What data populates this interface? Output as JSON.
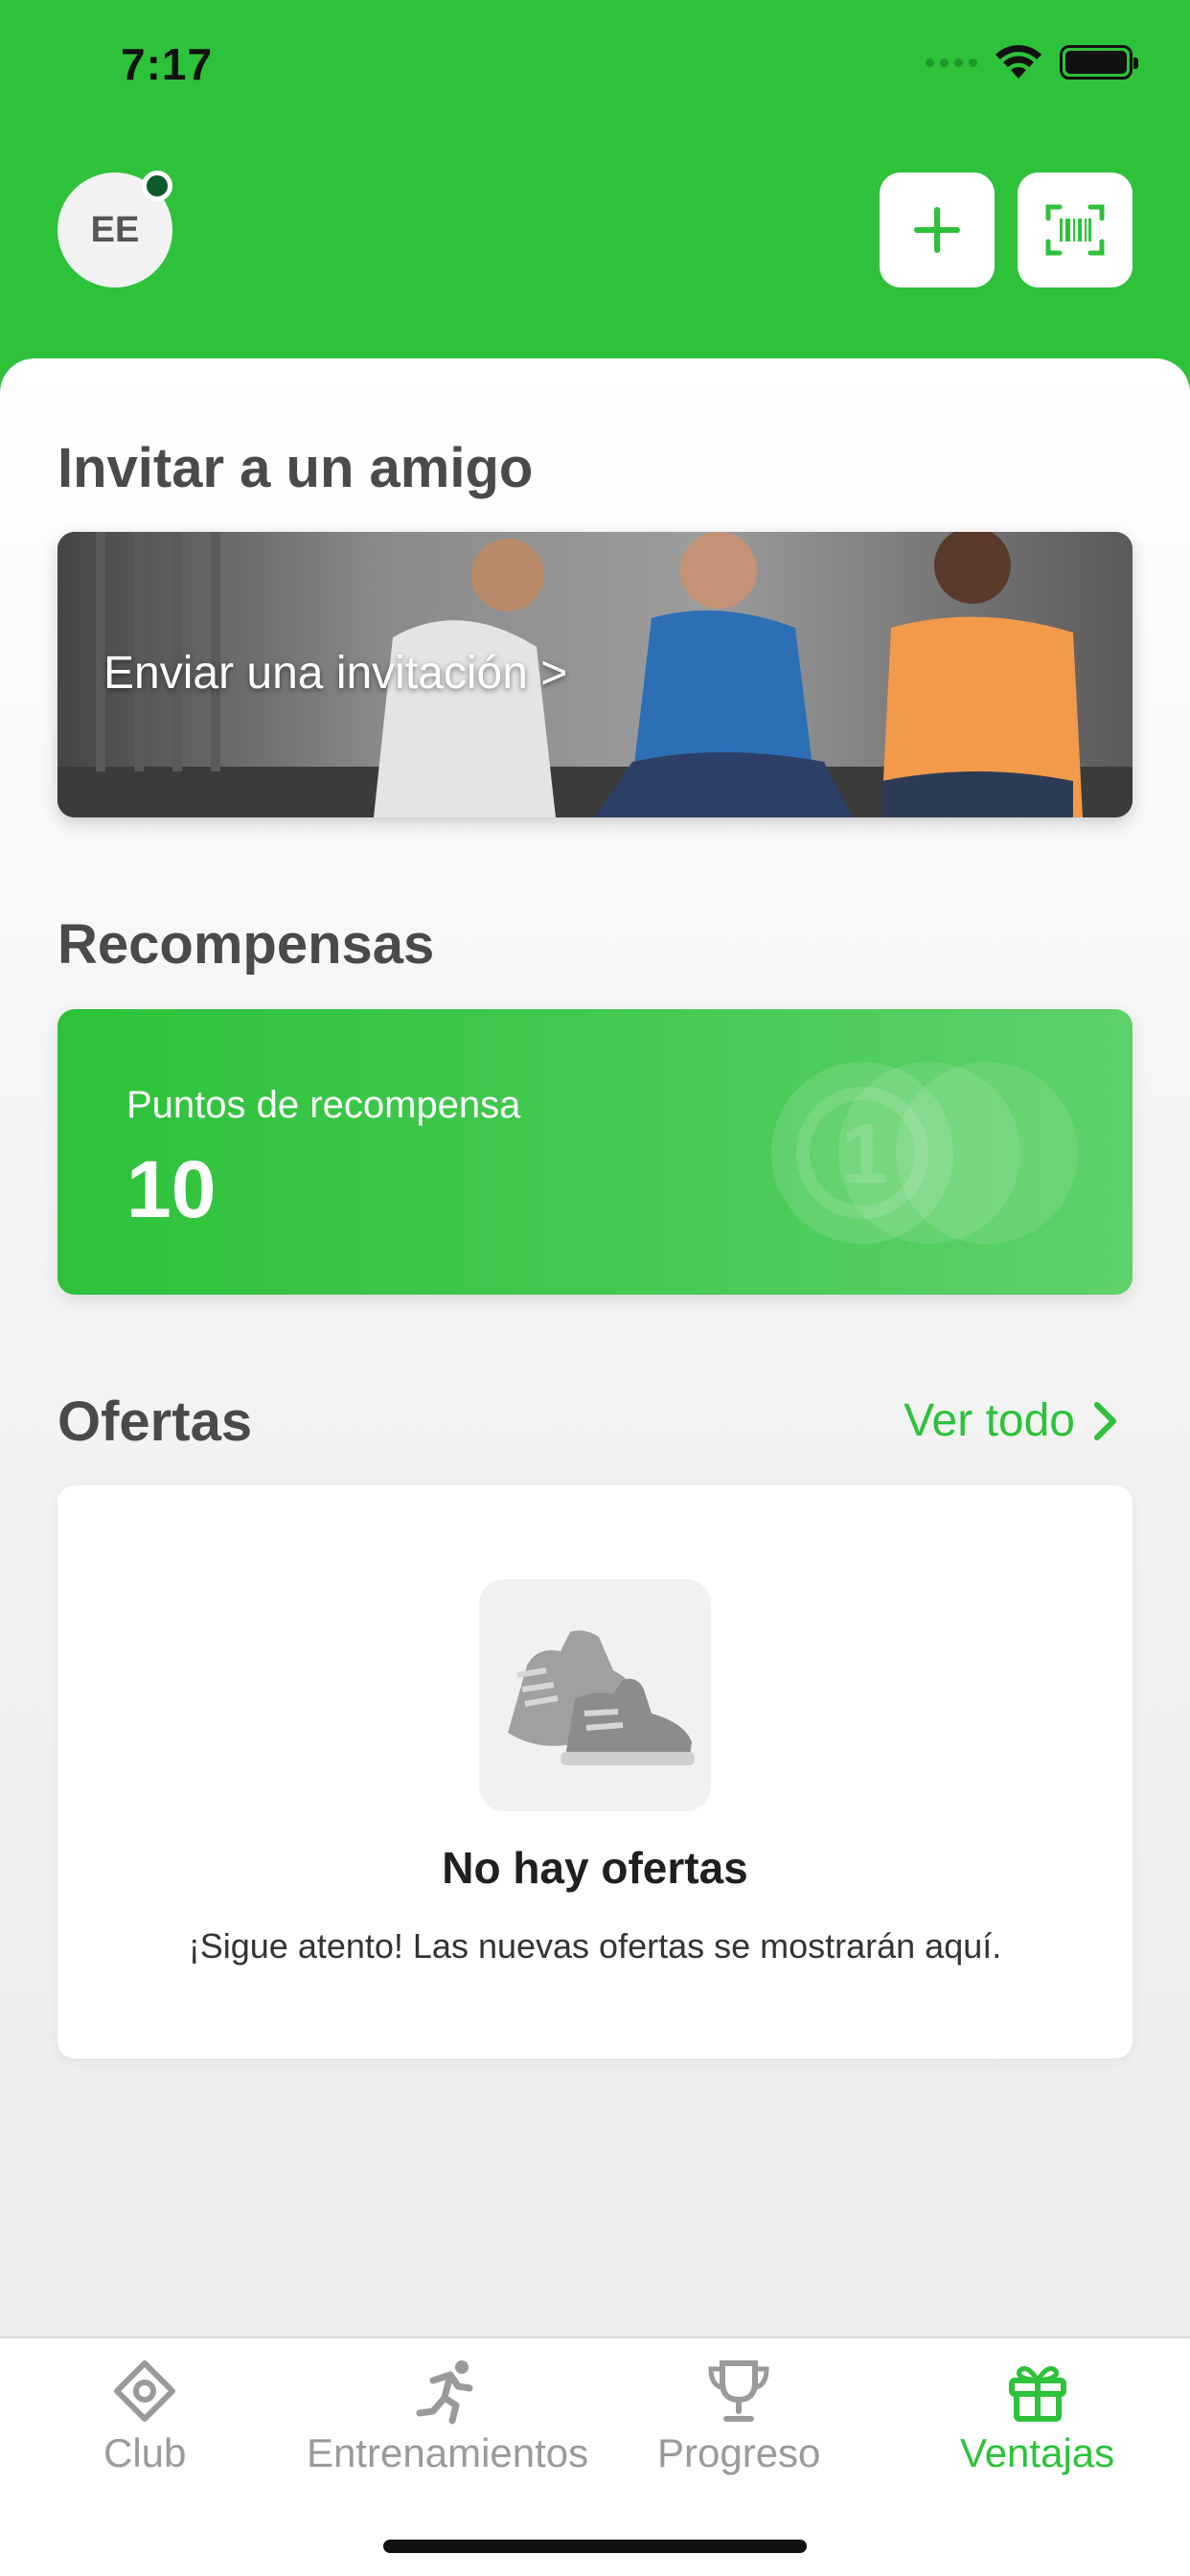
{
  "status_bar": {
    "time": "7:17"
  },
  "header": {
    "avatar_initials": "EE",
    "add_icon": "plus-icon",
    "scan_icon": "barcode-scan-icon"
  },
  "invite": {
    "section_title": "Invitar a un amigo",
    "banner_text": "Enviar una invitación >"
  },
  "rewards": {
    "section_title": "Recompensas",
    "label": "Puntos de recompensa",
    "value": "10",
    "coin_number": "1"
  },
  "offers": {
    "section_title": "Ofertas",
    "see_all_label": "Ver todo",
    "empty_title": "No hay ofertas",
    "empty_text": "¡Sigue atento! Las nuevas ofertas se mostrarán aquí."
  },
  "tabbar": {
    "items": [
      {
        "label": "Club",
        "icon": "club-diamond-icon"
      },
      {
        "label": "Entrenamientos",
        "icon": "running-icon"
      },
      {
        "label": "Progreso",
        "icon": "trophy-icon"
      },
      {
        "label": "Ventajas",
        "icon": "gift-icon",
        "active": true
      }
    ]
  },
  "colors": {
    "brand_green": "#2dc23a",
    "text_dark": "#4a4a4a",
    "tab_inactive": "#9a9a9a"
  }
}
